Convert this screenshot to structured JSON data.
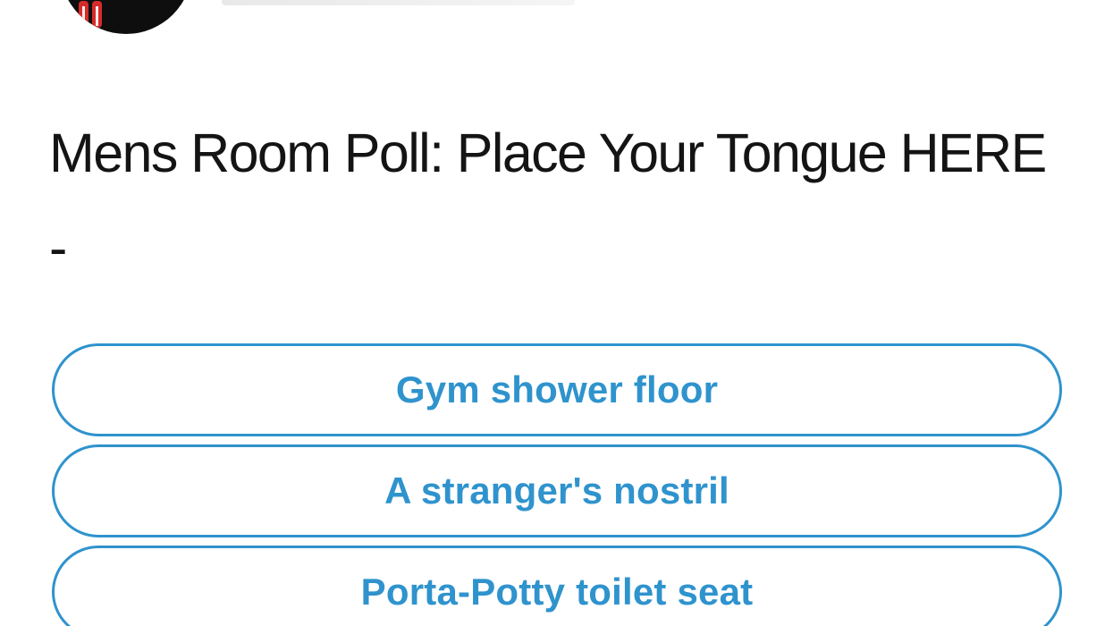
{
  "colors": {
    "accent": "#2f93cd",
    "question_text": "#141414",
    "avatar_bg": "#0e0e0e",
    "logo_red": "#d52b2b"
  },
  "header": {
    "avatar_icon": "logo-avatar"
  },
  "poll": {
    "question": "Mens Room Poll: Place Your Tongue HERE -",
    "options": [
      {
        "label": "Gym shower floor"
      },
      {
        "label": "A stranger's nostril"
      },
      {
        "label": "Porta-Potty toilet seat"
      }
    ]
  }
}
